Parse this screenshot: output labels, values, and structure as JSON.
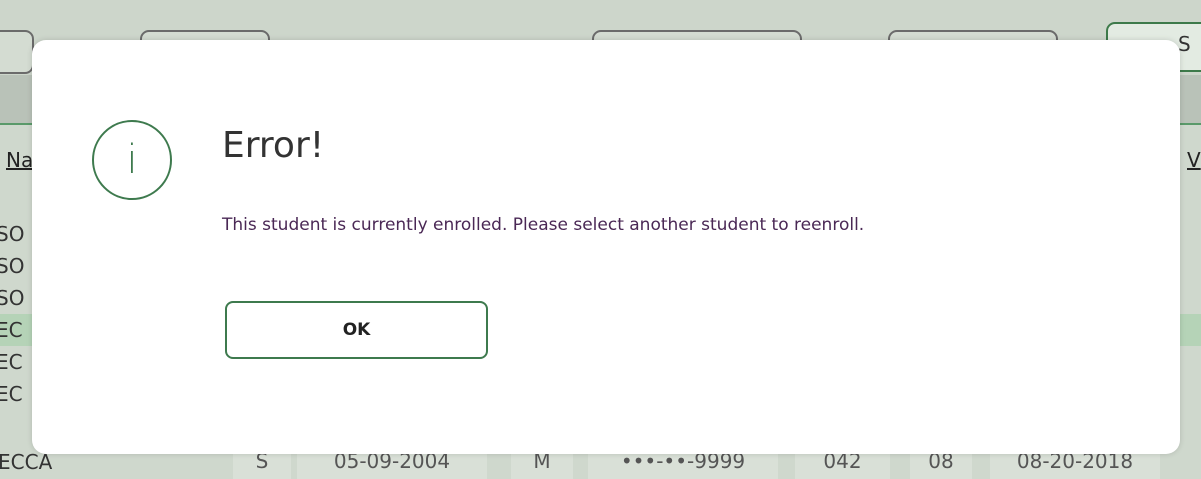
{
  "background": {
    "toolbar_partial_label": "S",
    "col_header_left": "Na",
    "col_header_right": "V",
    "row_fragments": [
      "SO",
      "SO",
      "SO",
      "EC",
      "EC",
      "EC"
    ],
    "last_row": {
      "name": "ECCA",
      "col1": "S",
      "dob": "05-09-2004",
      "sex": "M",
      "ssn": "•••-••-9999",
      "campus": "042",
      "grade": "08",
      "date": "08-20-2018"
    }
  },
  "dialog": {
    "icon": "info-icon",
    "icon_glyph": "i",
    "title": "Error!",
    "message": "This student is currently enrolled. Please select another student to reenroll.",
    "ok_label": "OK",
    "accent_color": "#3e7a4e"
  }
}
